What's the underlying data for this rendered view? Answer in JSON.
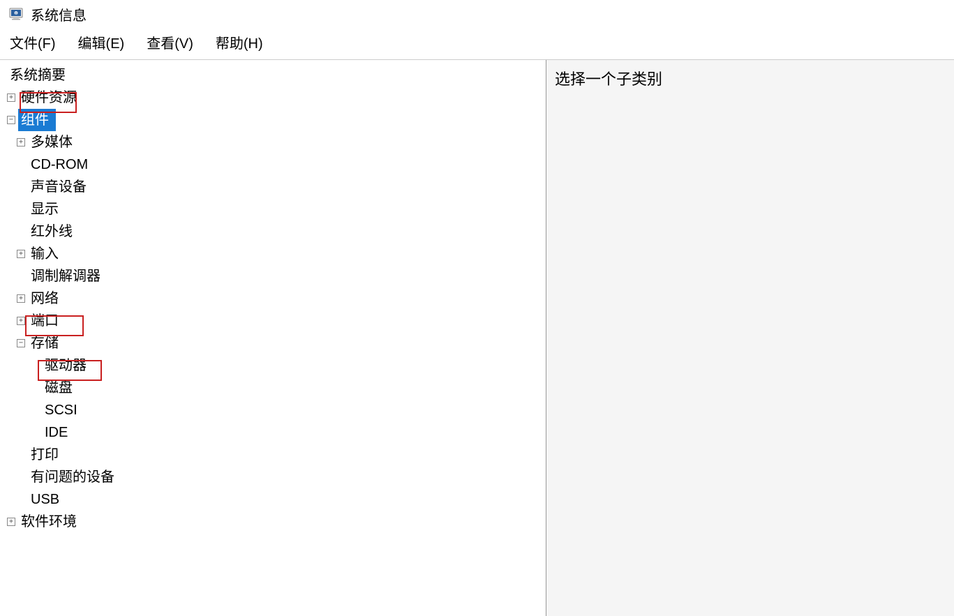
{
  "window": {
    "title": "系统信息"
  },
  "menu": {
    "file": "文件(F)",
    "edit": "编辑(E)",
    "view": "查看(V)",
    "help": "帮助(H)"
  },
  "detail": {
    "message": "选择一个子类别"
  },
  "tree": {
    "system_summary": "系统摘要",
    "hardware_resources": "硬件资源",
    "components": "组件",
    "multimedia": "多媒体",
    "cdrom": "CD-ROM",
    "sound_device": "声音设备",
    "display": "显示",
    "infrared": "红外线",
    "input": "输入",
    "modem": "调制解调器",
    "network": "网络",
    "ports": "端口",
    "storage": "存储",
    "drives": "驱动器",
    "disks": "磁盘",
    "scsi": "SCSI",
    "ide": "IDE",
    "printing": "打印",
    "problem_devices": "有问题的设备",
    "usb": "USB",
    "software_environment": "软件环境"
  },
  "expanders": {
    "plus": "+",
    "minus": "−"
  }
}
